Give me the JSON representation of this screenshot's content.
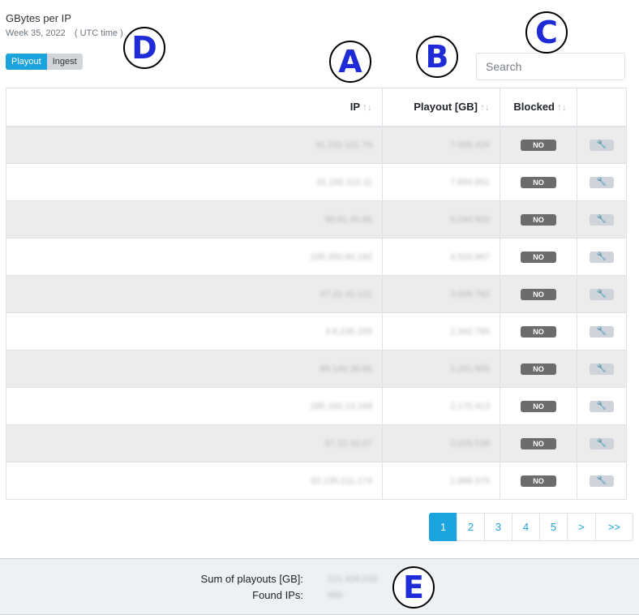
{
  "header": {
    "title": "GBytes per IP",
    "week": "Week 35, 2022",
    "timezone": "( UTC time )"
  },
  "toggle": {
    "playout": "Playout",
    "ingest": "Ingest",
    "active": "Playout"
  },
  "search": {
    "placeholder": "Search",
    "value": ""
  },
  "markers": {
    "a": "A",
    "b": "B",
    "c": "C",
    "d": "D",
    "e": "E"
  },
  "table": {
    "columns": {
      "ip": "IP",
      "playout": "Playout [GB]",
      "blocked": "Blocked",
      "sort_glyph": "↑↓"
    },
    "action_icon": "wrench-icon",
    "rows": [
      {
        "ip": "31.192.121.79",
        "playout": "7.996.424",
        "blocked": "NO"
      },
      {
        "ip": "31.192.112.11",
        "playout": "7.893.651",
        "blocked": "NO"
      },
      {
        "ip": "80.81.45.66",
        "playout": "5.244.903",
        "blocked": "NO"
      },
      {
        "ip": "195.250.80.182",
        "playout": "4.520.867",
        "blocked": "NO"
      },
      {
        "ip": "67.22.42.121",
        "playout": "3.699.783",
        "blocked": "NO"
      },
      {
        "ip": "3.6.235.155",
        "playout": "2.342.785",
        "blocked": "NO"
      },
      {
        "ip": "89.149.36.66",
        "playout": "2.291.855",
        "blocked": "NO"
      },
      {
        "ip": "185.192.13.249",
        "playout": "2.170.413",
        "blocked": "NO"
      },
      {
        "ip": "67.22.42.67",
        "playout": "2.029.538",
        "blocked": "NO"
      },
      {
        "ip": "82.135.211.174",
        "playout": "1.686.570",
        "blocked": "NO"
      }
    ]
  },
  "pagination": {
    "pages": [
      "1",
      "2",
      "3",
      "4",
      "5",
      ">",
      ">>"
    ],
    "current": "1"
  },
  "footer": {
    "sum_label": "Sum of playouts [GB]:",
    "sum_value": "121.439.019",
    "found_label": "Found IPs:",
    "found_value": "999"
  },
  "colors": {
    "accent": "#1aa3dc",
    "badge": "#6c6c6c",
    "stripe": "#ececec",
    "marker_text": "#1f2bd6"
  }
}
